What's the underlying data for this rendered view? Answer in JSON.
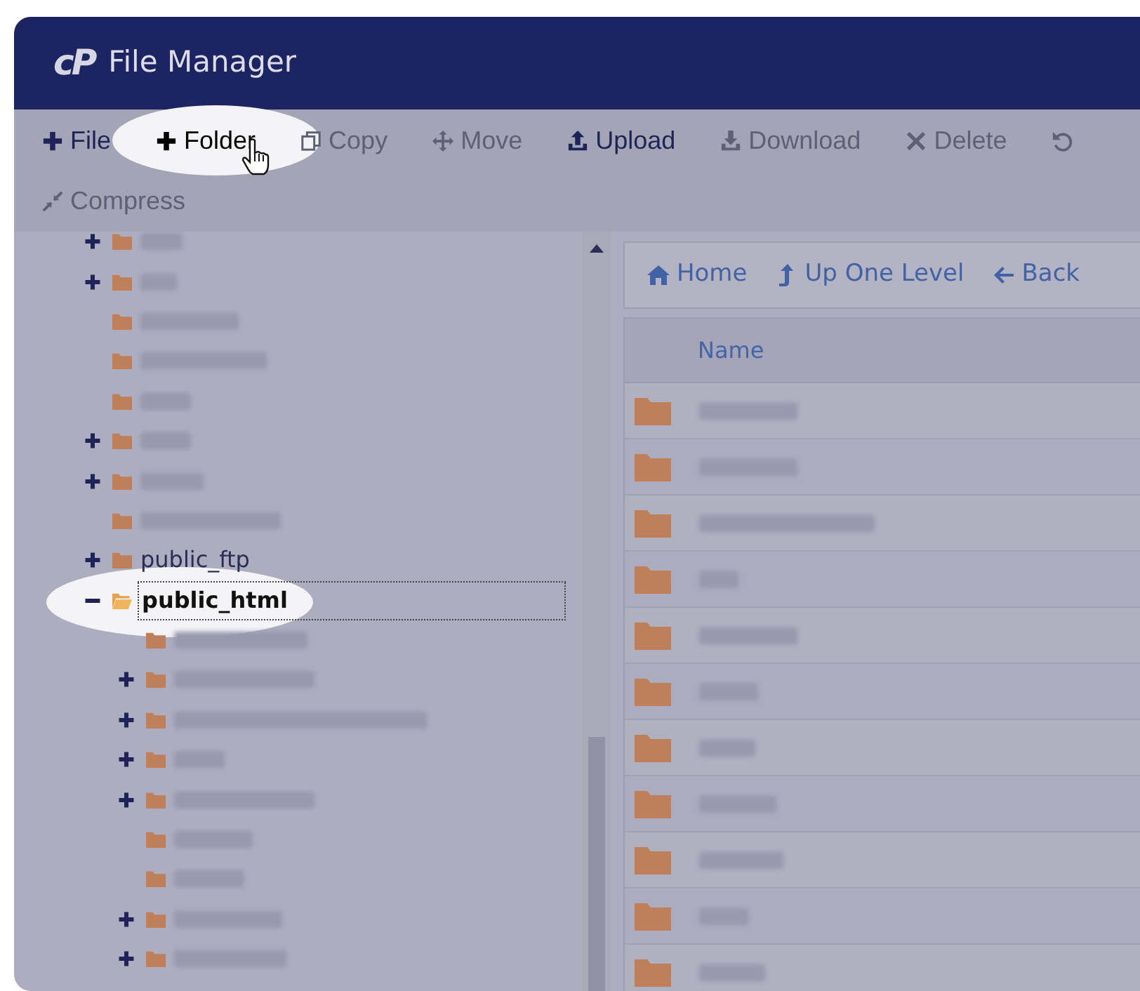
{
  "window": {
    "logo": "cP",
    "title": "File Manager"
  },
  "toolbar": {
    "rows": [
      [
        {
          "label": "File",
          "disabled": false,
          "highlighted": false
        },
        {
          "label": "Folder",
          "disabled": false,
          "highlighted": true
        },
        {
          "label": "Copy",
          "disabled": true,
          "highlighted": false
        },
        {
          "label": "Move",
          "disabled": true,
          "highlighted": false
        },
        {
          "label": "Upload",
          "disabled": false,
          "highlighted": false
        },
        {
          "label": "Download",
          "disabled": true,
          "highlighted": false
        },
        {
          "label": "Delete",
          "disabled": true,
          "highlighted": false
        },
        {
          "disabled": true,
          "highlighted": false
        }
      ],
      [
        {
          "label": "Compress",
          "disabled": true,
          "highlighted": false
        }
      ]
    ]
  },
  "tree": {
    "items": [
      {
        "expandable": true,
        "expanded": false,
        "selected": false,
        "highlighted": false
      },
      {
        "expandable": true,
        "expanded": false,
        "selected": false,
        "highlighted": false
      },
      {
        "expandable": false,
        "expanded": false,
        "selected": false,
        "highlighted": false
      },
      {
        "expandable": false,
        "expanded": false,
        "selected": false,
        "highlighted": false
      },
      {
        "expandable": false,
        "expanded": false,
        "selected": false,
        "highlighted": false
      },
      {
        "expandable": true,
        "expanded": false,
        "selected": false,
        "highlighted": false
      },
      {
        "expandable": true,
        "expanded": false,
        "selected": false,
        "highlighted": false
      },
      {
        "expandable": false,
        "expanded": false,
        "selected": false,
        "highlighted": false
      },
      {
        "expandable": true,
        "expanded": false,
        "label": "public_ftp",
        "selected": false,
        "highlighted": false
      },
      {
        "expandable": true,
        "expanded": true,
        "label": "public_html",
        "selected": true,
        "highlighted": true,
        "children": [
          {
            "expandable": false,
            "expanded": false,
            "selected": false,
            "highlighted": false
          },
          {
            "expandable": true,
            "expanded": false,
            "selected": false,
            "highlighted": false
          },
          {
            "expandable": true,
            "expanded": false,
            "selected": false,
            "highlighted": false
          },
          {
            "expandable": true,
            "expanded": false,
            "selected": false,
            "highlighted": false
          },
          {
            "expandable": true,
            "expanded": false,
            "selected": false,
            "highlighted": false
          },
          {
            "expandable": false,
            "expanded": false,
            "selected": false,
            "highlighted": false
          },
          {
            "expandable": false,
            "expanded": false,
            "selected": false,
            "highlighted": false
          },
          {
            "expandable": true,
            "expanded": false,
            "selected": false,
            "highlighted": false
          },
          {
            "expandable": true,
            "expanded": false,
            "selected": false,
            "highlighted": false
          }
        ]
      }
    ]
  },
  "nav": [
    {
      "label": "Home"
    },
    {
      "label": "Up One Level"
    },
    {
      "label": "Back"
    }
  ],
  "table": {
    "columns": [
      "Name"
    ],
    "rows": [
      {
        "kind": "folder"
      },
      {
        "kind": "folder"
      },
      {
        "kind": "folder"
      },
      {
        "kind": "folder"
      },
      {
        "kind": "folder"
      },
      {
        "kind": "folder"
      },
      {
        "kind": "folder"
      },
      {
        "kind": "folder"
      },
      {
        "kind": "folder"
      },
      {
        "kind": "folder"
      },
      {
        "kind": "folder"
      }
    ]
  }
}
